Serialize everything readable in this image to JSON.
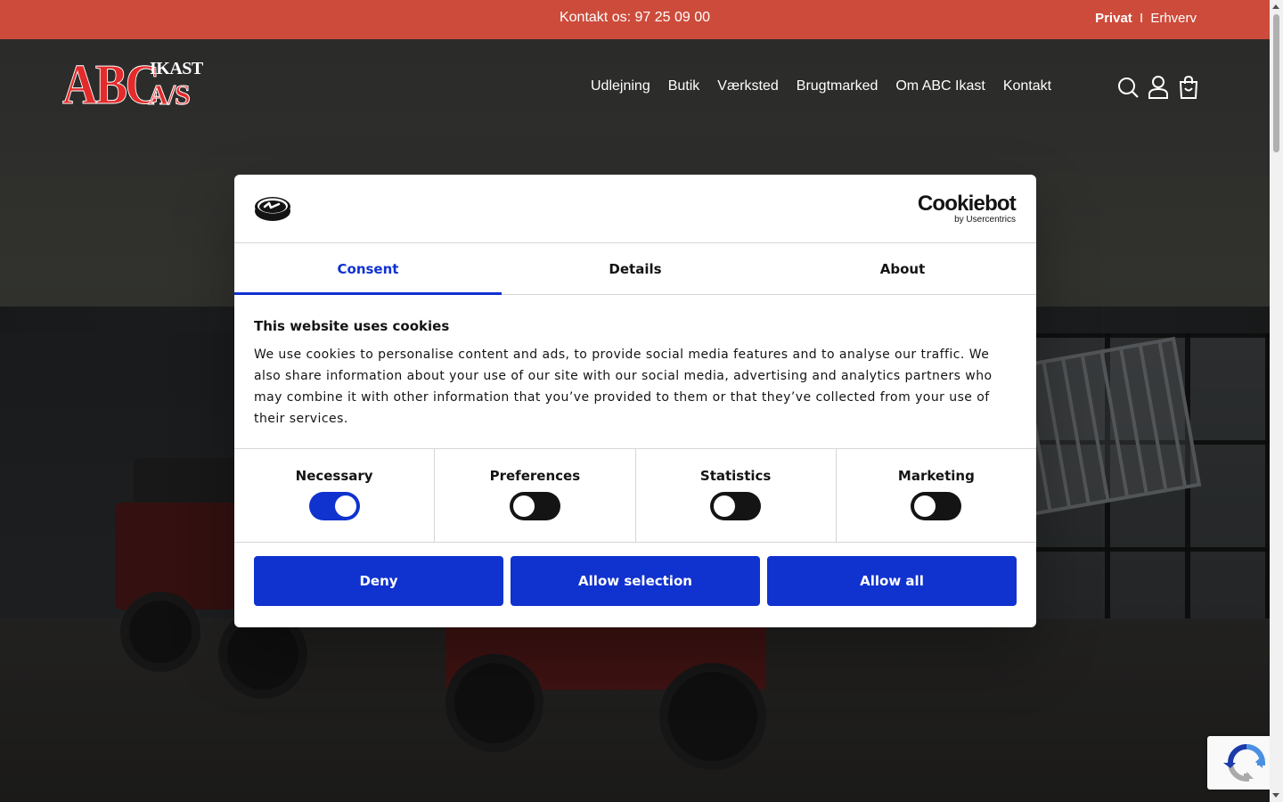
{
  "topbar": {
    "contact": "Kontakt os: 97 25 09 00",
    "segment_active": "Privat",
    "segment_separator": "I",
    "segment_other": "Erhverv"
  },
  "logo": {
    "abc": "ABC",
    "ikast": "IKAST",
    "as": "A/S"
  },
  "nav": {
    "items": [
      "Udlejning",
      "Butik",
      "Værksted",
      "Brugtmarked",
      "Om ABC Ikast",
      "Kontakt"
    ]
  },
  "header_icons": [
    "search-icon",
    "user-icon",
    "cart-icon"
  ],
  "cookie_dialog": {
    "brand": "Cookiebot",
    "brand_sub": "by Usercentrics",
    "tabs": [
      "Consent",
      "Details",
      "About"
    ],
    "active_tab": "Consent",
    "title": "This website uses cookies",
    "text": "We use cookies to personalise content and ads, to provide social media features and to analyse our traffic. We also share information about your use of our site with our social media, advertising and analytics partners who may combine it with other information that you’ve provided to them or that they’ve collected from your use of their services.",
    "toggles": [
      {
        "label": "Necessary",
        "on": true
      },
      {
        "label": "Preferences",
        "on": false
      },
      {
        "label": "Statistics",
        "on": false
      },
      {
        "label": "Marketing",
        "on": false
      }
    ],
    "buttons": {
      "deny": "Deny",
      "allow_selection": "Allow selection",
      "allow_all": "Allow all"
    }
  },
  "colors": {
    "topbar": "#cd4b3b",
    "accent_blue": "#1032cf",
    "logo_red": "#e32b2b"
  }
}
